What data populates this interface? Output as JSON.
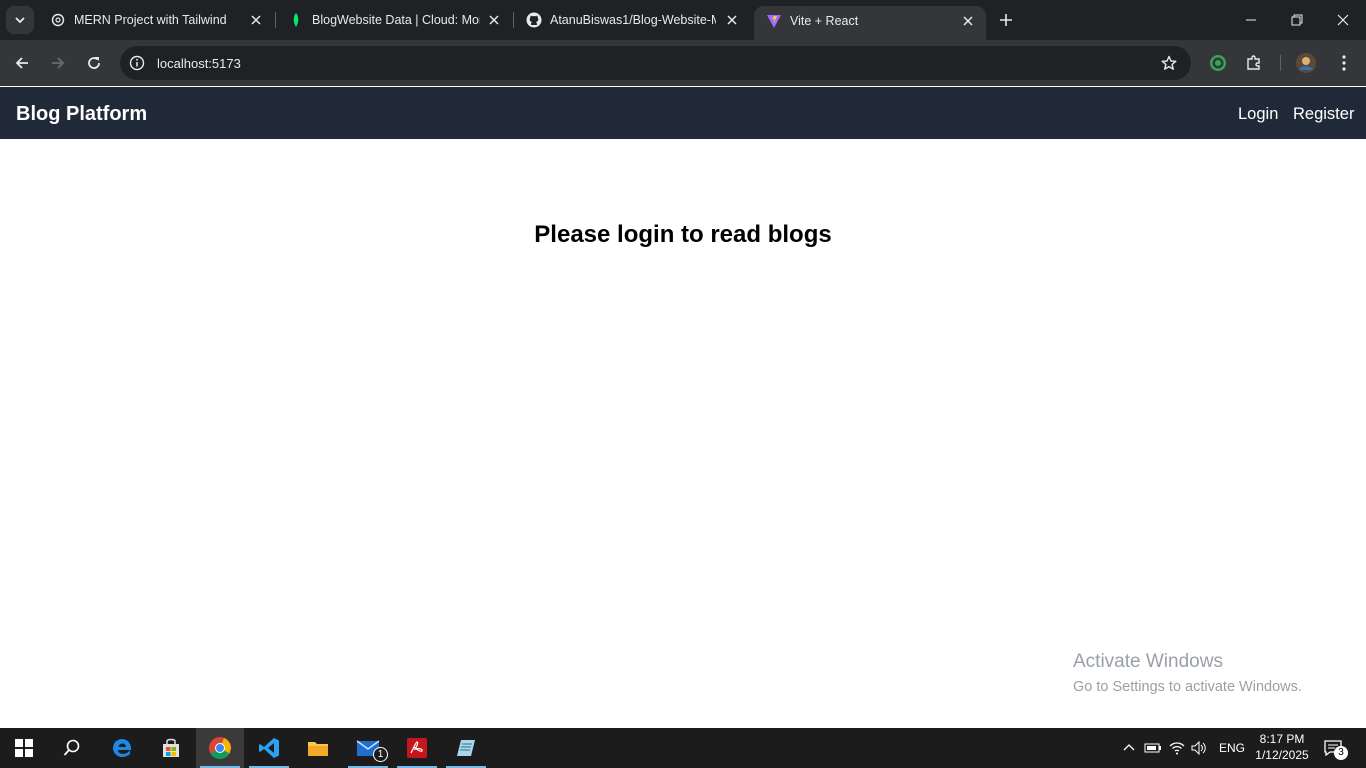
{
  "browser": {
    "tabs": [
      {
        "title": "MERN Project with Tailwind",
        "favicon": "openai-icon",
        "active": false
      },
      {
        "title": "BlogWebsite Data | Cloud: Mon",
        "favicon": "mongodb-leaf-icon",
        "active": false
      },
      {
        "title": "AtanuBiswas1/Blog-Website-M",
        "favicon": "github-icon",
        "active": false
      },
      {
        "title": "Vite + React",
        "favicon": "vite-icon",
        "active": true
      }
    ],
    "url": "localhost:5173"
  },
  "app": {
    "brand": "Blog Platform",
    "nav": {
      "login": "Login",
      "register": "Register"
    },
    "message": "Please login to read blogs",
    "colors": {
      "navbar": "#1f2937",
      "text": "#ffffff"
    }
  },
  "watermark": {
    "line1": "Activate Windows",
    "line2": "Go to Settings to activate Windows."
  },
  "taskbar": {
    "apps": [
      "start-icon",
      "search-icon",
      "edge-icon",
      "store-icon",
      "chrome-icon",
      "vscode-icon",
      "file-explorer-icon",
      "mail-icon",
      "acrobat-icon",
      "notepad-icon"
    ],
    "mail_badge": "1",
    "language": "ENG",
    "time": "8:17 PM",
    "date": "1/12/2025",
    "notification_count": "3"
  }
}
